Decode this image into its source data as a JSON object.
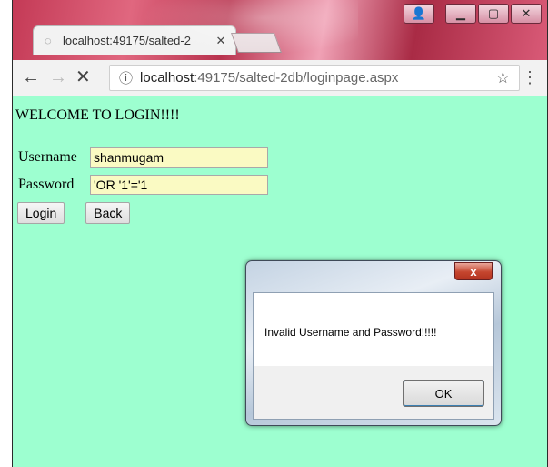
{
  "browser": {
    "tab": {
      "title": "localhost:49175/salted-2",
      "close_icon": "close-icon"
    },
    "window_buttons": {
      "user": "user-icon",
      "minimize": "minimize-icon",
      "maximize": "maximize-icon",
      "close": "close-icon"
    },
    "toolbar": {
      "back": "←",
      "forward": "→",
      "stop": "✕",
      "url_host": "localhost",
      "url_path": ":49175/salted-2db/loginpage.aspx",
      "info": "ⓘ",
      "star": "☆",
      "menu": "⋮"
    }
  },
  "page": {
    "welcome": "WELCOME TO LOGIN!!!!",
    "username_label": "Username",
    "username_value": "shanmugam",
    "password_label": "Password",
    "password_value": "'OR '1'='1",
    "login_button": "Login",
    "back_button": "Back",
    "background_color": "#9dffd0"
  },
  "dialog": {
    "message": "Invalid Username and Password!!!!!",
    "ok_button": "OK",
    "close": "x"
  }
}
